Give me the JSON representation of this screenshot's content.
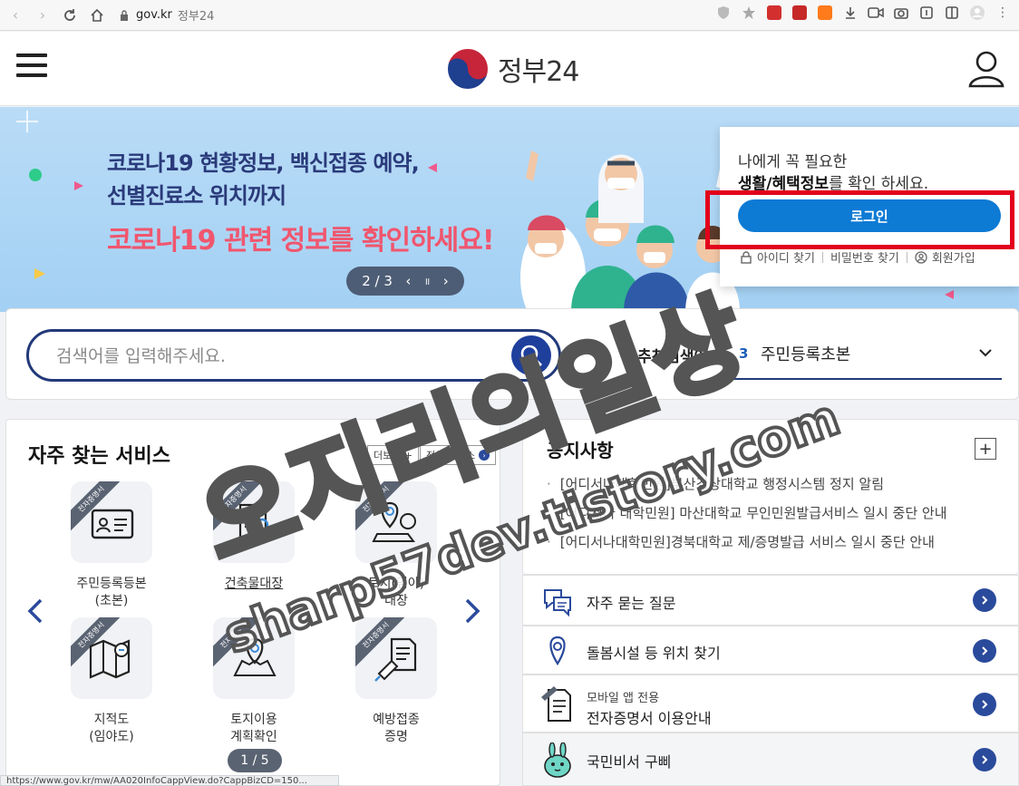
{
  "browser": {
    "domain": "gov.kr",
    "tab_title": "정부24"
  },
  "header": {
    "logo_text": "정부24"
  },
  "hero": {
    "line1": "코로나19 현황정보, 백신접종 예약,",
    "line2": "선별진료소 위치까지",
    "line3": "코로나19 관련 정보를 확인하세요!",
    "pager": "2 / 3",
    "prev": "‹",
    "pause": "॥",
    "next": "›"
  },
  "login_card": {
    "line1": "나에게 꼭 필요한",
    "line2_bold": "생활/혜택정보",
    "line2_rest": "를 확인 하세요.",
    "login_label": "로그인",
    "find_id": "아이디 찾기",
    "find_pw": "비밀번호 찾기",
    "signup": "회원가입"
  },
  "search": {
    "placeholder": "검색어를 입력해주세요.",
    "rec_label": "추천검색어",
    "rec_num": "3",
    "rec_text": "주민등록초본"
  },
  "services": {
    "title": "자주 찾는 서비스",
    "more": "더보기 +",
    "all": "전체 서비스",
    "ribbon": "전자증명서",
    "items": [
      {
        "label": "주민등록등본\n(초본)"
      },
      {
        "label": "건축물대장"
      },
      {
        "label": "토지(임야)\n대장"
      },
      {
        "label": "지적도\n(임야도)"
      },
      {
        "label": "토지이용\n계획확인"
      },
      {
        "label": "예방접종\n증명"
      }
    ],
    "pager": "1 / 5"
  },
  "notices": {
    "title": "공지사항",
    "items": [
      "[어디서나대학민원]부산경상대학교 행정시스템 정지 알림",
      "[어디서나 대학민원] 마산대학교 무인민원발급서비스 일시 중단 안내",
      "[어디서나대학민원]경북대학교 제/증명발급 서비스 일시 중단 안내"
    ]
  },
  "links": {
    "faq": "자주 묻는 질문",
    "care": "돌봄시설 등 위치 찾기",
    "mobile_sub": "모바일 앱 전용",
    "mobile_main": "전자증명서 이용안내",
    "assistant": "국민비서 구삐"
  },
  "status_bar": "https://www.gov.kr/mw/AA020InfoCappView.do?CappBizCD=150...",
  "watermark": {
    "big": "오지리의일상",
    "small": "sharp57dev.tistory.com"
  },
  "colors": {
    "accent": "#0d7ad4",
    "navy": "#223a7a",
    "highlight": "#e3001b",
    "hero_pink": "#f0566e"
  }
}
